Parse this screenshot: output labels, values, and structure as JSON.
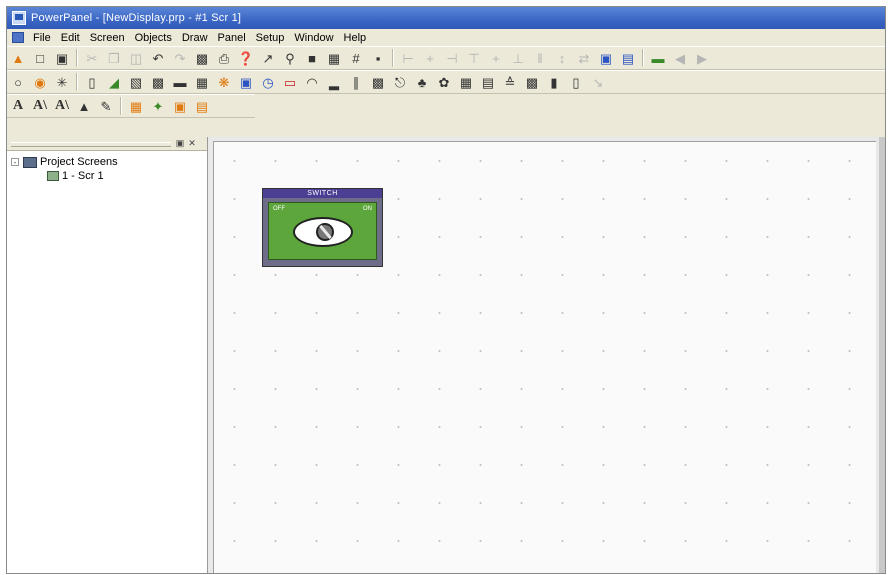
{
  "window": {
    "title": "PowerPanel - [NewDisplay.prp - #1 Scr 1]"
  },
  "menu": [
    "File",
    "Edit",
    "Screen",
    "Objects",
    "Draw",
    "Panel",
    "Setup",
    "Window",
    "Help"
  ],
  "toolbar3": {
    "text_tool_1": "A",
    "text_tool_2": "A\\",
    "text_tool_3": "A\\"
  },
  "sidebar": {
    "tree": {
      "root_label": "Project Screens",
      "root_expander": "-",
      "children": [
        {
          "label": "1 - Scr 1"
        }
      ]
    }
  },
  "canvas": {
    "switch_widget": {
      "title": "SWITCH",
      "off_label": "OFF",
      "on_label": "ON"
    }
  }
}
